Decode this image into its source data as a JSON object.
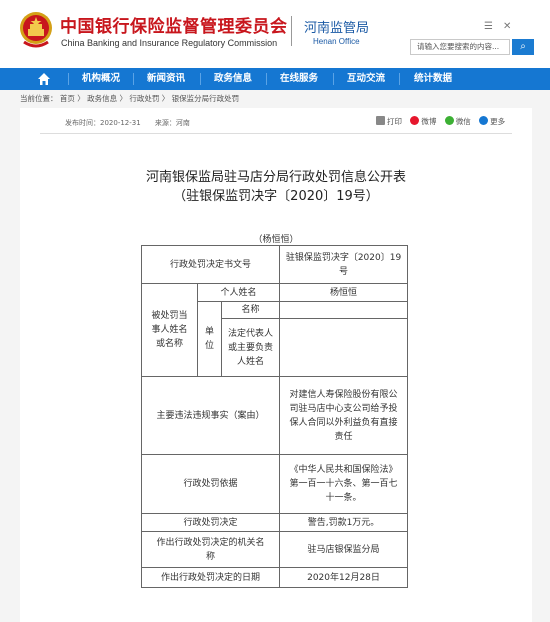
{
  "header": {
    "brand_cn": "中国银行保险监督管理委员会",
    "brand_en": "China Banking and Insurance Regulatory Commission",
    "office_cn": "河南监管局",
    "office_en": "Henan Office",
    "search_placeholder": "请输入您要搜索的内容...",
    "icons": [
      "list-icon",
      "close-icon"
    ]
  },
  "nav": {
    "items": [
      "机构概况",
      "新闻资讯",
      "政务信息",
      "在线服务",
      "互动交流",
      "统计数据"
    ]
  },
  "breadcrumb": {
    "text": "当前位置：  首页 〉 政务信息 〉 行政处罚 〉 银保监分局行政处罚"
  },
  "article": {
    "publish_time": "发布时间：2020-12-31",
    "source": "来源：河南",
    "share": {
      "print": "打印",
      "weibo": "微博",
      "wechat": "微信",
      "more": "更多"
    },
    "title_line1": "河南银保监局驻马店分局行政处罚信息公开表",
    "title_line2": "（驻银保监罚决字〔2020〕19号）",
    "person": "（杨恒恒）"
  },
  "table": {
    "decision_no_label": "行政处罚决定书文号",
    "decision_no_value_l1": "驻银保监罚决字〔2020〕19",
    "decision_no_value_l2": "号",
    "party_label_l1": "被处罚当",
    "party_label_l2": "事人姓名",
    "party_label_l3": "或名称",
    "individual_label": "个人姓名",
    "individual_value": "杨恒恒",
    "unit_label_l1": "单",
    "unit_label_l2": "位",
    "name_label": "名称",
    "legal_rep_l1": "法定代表人",
    "legal_rep_l2": "或主要负责",
    "legal_rep_l3": "人姓名",
    "facts_label": "主要违法违规事实（案由）",
    "facts_l1": "对建信人寿保险股份有限公",
    "facts_l2": "司驻马店中心支公司给予投",
    "facts_l3": "保人合同以外利益负有直接",
    "facts_l4": "责任",
    "basis_label": "行政处罚依据",
    "basis_l1": "《中华人民共和国保险法》",
    "basis_l2": "第一百一十六条、第一百七",
    "basis_l3": "十一条。",
    "decision_label": "行政处罚决定",
    "decision_value": "警告,罚款1万元。",
    "authority_label_l1": "作出行政处罚决定的机关名",
    "authority_label_l2": "称",
    "authority_value": "驻马店银保监分局",
    "date_label": "作出行政处罚决定的日期",
    "date_value": "2020年12月28日"
  },
  "colors": {
    "brand_red": "#c8161d",
    "nav_blue": "#1577d2",
    "office_blue": "#1b5aa5"
  }
}
